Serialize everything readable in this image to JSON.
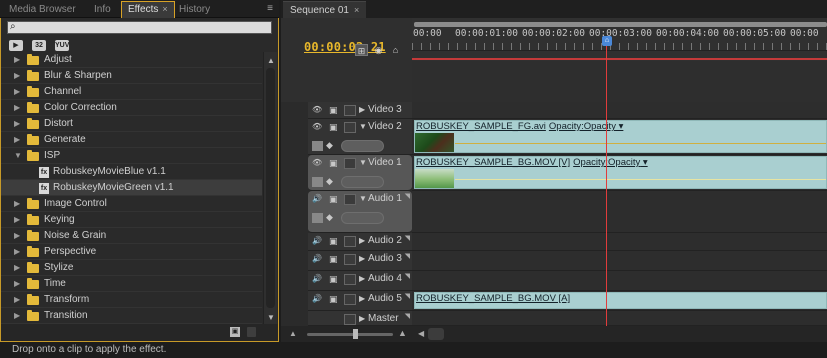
{
  "left_panel": {
    "tabs": [
      {
        "label": "Media Browser"
      },
      {
        "label": "Info"
      },
      {
        "label": "Effects",
        "close": "×"
      },
      {
        "label": "History"
      }
    ],
    "menu_icon": "≡",
    "search": {
      "value": "",
      "placeholder": ""
    },
    "toolbar": {
      "accel_label": "32",
      "yuv_label": "YUV"
    },
    "tree": [
      {
        "label": "Adjust",
        "type": "folder",
        "expanded": false
      },
      {
        "label": "Blur & Sharpen",
        "type": "folder",
        "expanded": false
      },
      {
        "label": "Channel",
        "type": "folder",
        "expanded": false
      },
      {
        "label": "Color Correction",
        "type": "folder",
        "expanded": false
      },
      {
        "label": "Distort",
        "type": "folder",
        "expanded": false
      },
      {
        "label": "Generate",
        "type": "folder",
        "expanded": false
      },
      {
        "label": "ISP",
        "type": "folder",
        "expanded": true
      },
      {
        "label": "RobuskeyMovieBlue v1.1",
        "type": "effect"
      },
      {
        "label": "RobuskeyMovieGreen v1.1",
        "type": "effect",
        "selected": true
      },
      {
        "label": "Image Control",
        "type": "folder",
        "expanded": false
      },
      {
        "label": "Keying",
        "type": "folder",
        "expanded": false
      },
      {
        "label": "Noise & Grain",
        "type": "folder",
        "expanded": false
      },
      {
        "label": "Perspective",
        "type": "folder",
        "expanded": false
      },
      {
        "label": "Stylize",
        "type": "folder",
        "expanded": false
      },
      {
        "label": "Time",
        "type": "folder",
        "expanded": false
      },
      {
        "label": "Transform",
        "type": "folder",
        "expanded": false
      },
      {
        "label": "Transition",
        "type": "folder",
        "expanded": false
      }
    ]
  },
  "sequence": {
    "tab_label": "Sequence 01",
    "tab_close": "×",
    "timecode": "00:00:02:21",
    "ruler_labels": [
      "00:00",
      "00:00:01:00",
      "00:00:02:00",
      "00:00:03:00",
      "00:00:04:00",
      "00:00:05:00",
      "00:00"
    ],
    "tracks": [
      {
        "name": "Video 3",
        "kind": "video",
        "expanded": false
      },
      {
        "name": "Video 2",
        "kind": "video",
        "expanded": true,
        "clip": {
          "name": "ROBUSKEY_SAMPLE_FG.avi",
          "opacity": "Opacity:Opacity",
          "thumb": "fg"
        }
      },
      {
        "name": "Video 1",
        "kind": "video",
        "expanded": true,
        "target": true,
        "clip": {
          "name": "ROBUSKEY_SAMPLE_BG.MOV [V]",
          "opacity": "Opacity:Opacity",
          "thumb": "bg"
        }
      },
      {
        "name": "Audio 1",
        "kind": "audio",
        "expanded": true,
        "target": true
      },
      {
        "name": "Audio 2",
        "kind": "audio",
        "expanded": false
      },
      {
        "name": "Audio 3",
        "kind": "audio",
        "expanded": false
      },
      {
        "name": "Audio 4",
        "kind": "audio",
        "expanded": false
      },
      {
        "name": "Audio 5",
        "kind": "audio",
        "expanded": false,
        "clip": {
          "name": "ROBUSKEY_SAMPLE_BG.MOV [A]"
        }
      },
      {
        "name": "Master",
        "kind": "master",
        "expanded": false
      }
    ]
  },
  "status": {
    "message": "Drop onto a clip to apply the effect."
  },
  "colors": {
    "accent": "#d8a226",
    "timecode": "#e8b82b",
    "playhead": "#e03c3c",
    "clip": "#a9cfd0",
    "folder": "#e3b93a"
  }
}
